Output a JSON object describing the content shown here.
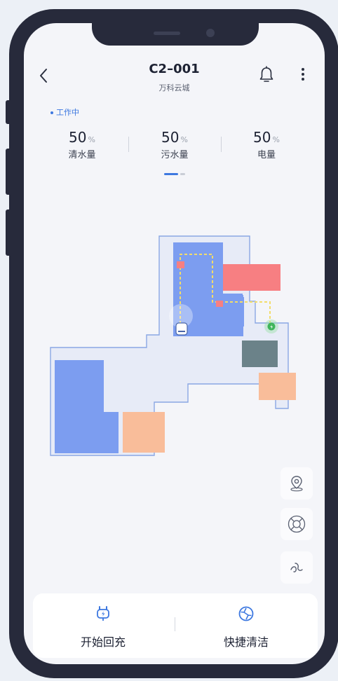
{
  "header": {
    "title": "C2–001",
    "subtitle": "万科云城"
  },
  "status": {
    "text": "工作中",
    "color": "#3d78e0"
  },
  "stats": [
    {
      "value": "50",
      "unit": "%",
      "label": "清水量"
    },
    {
      "value": "50",
      "unit": "%",
      "label": "污水量"
    },
    {
      "value": "50",
      "unit": "%",
      "label": "电量"
    }
  ],
  "pager": {
    "pages": 2,
    "active": 1
  },
  "map": {
    "colors": {
      "floor": "#e7ebf7",
      "floor_border": "#8aa7e4",
      "cleaned_area": "#7c9df0",
      "obstacle_red": "#f77f82",
      "obstacle_orange": "#f9bd9a",
      "obstacle_slate": "#6b8289",
      "charger": "#3fb55a"
    }
  },
  "tools": [
    {
      "icon": "location-pin-icon"
    },
    {
      "icon": "cleaning-brush-icon"
    },
    {
      "icon": "airflow-icon"
    }
  ],
  "actions": [
    {
      "icon": "charging-plug-icon",
      "label": "开始回充"
    },
    {
      "icon": "quick-clean-icon",
      "label": "快捷清洁"
    }
  ],
  "accent_color": "#3d78e0"
}
